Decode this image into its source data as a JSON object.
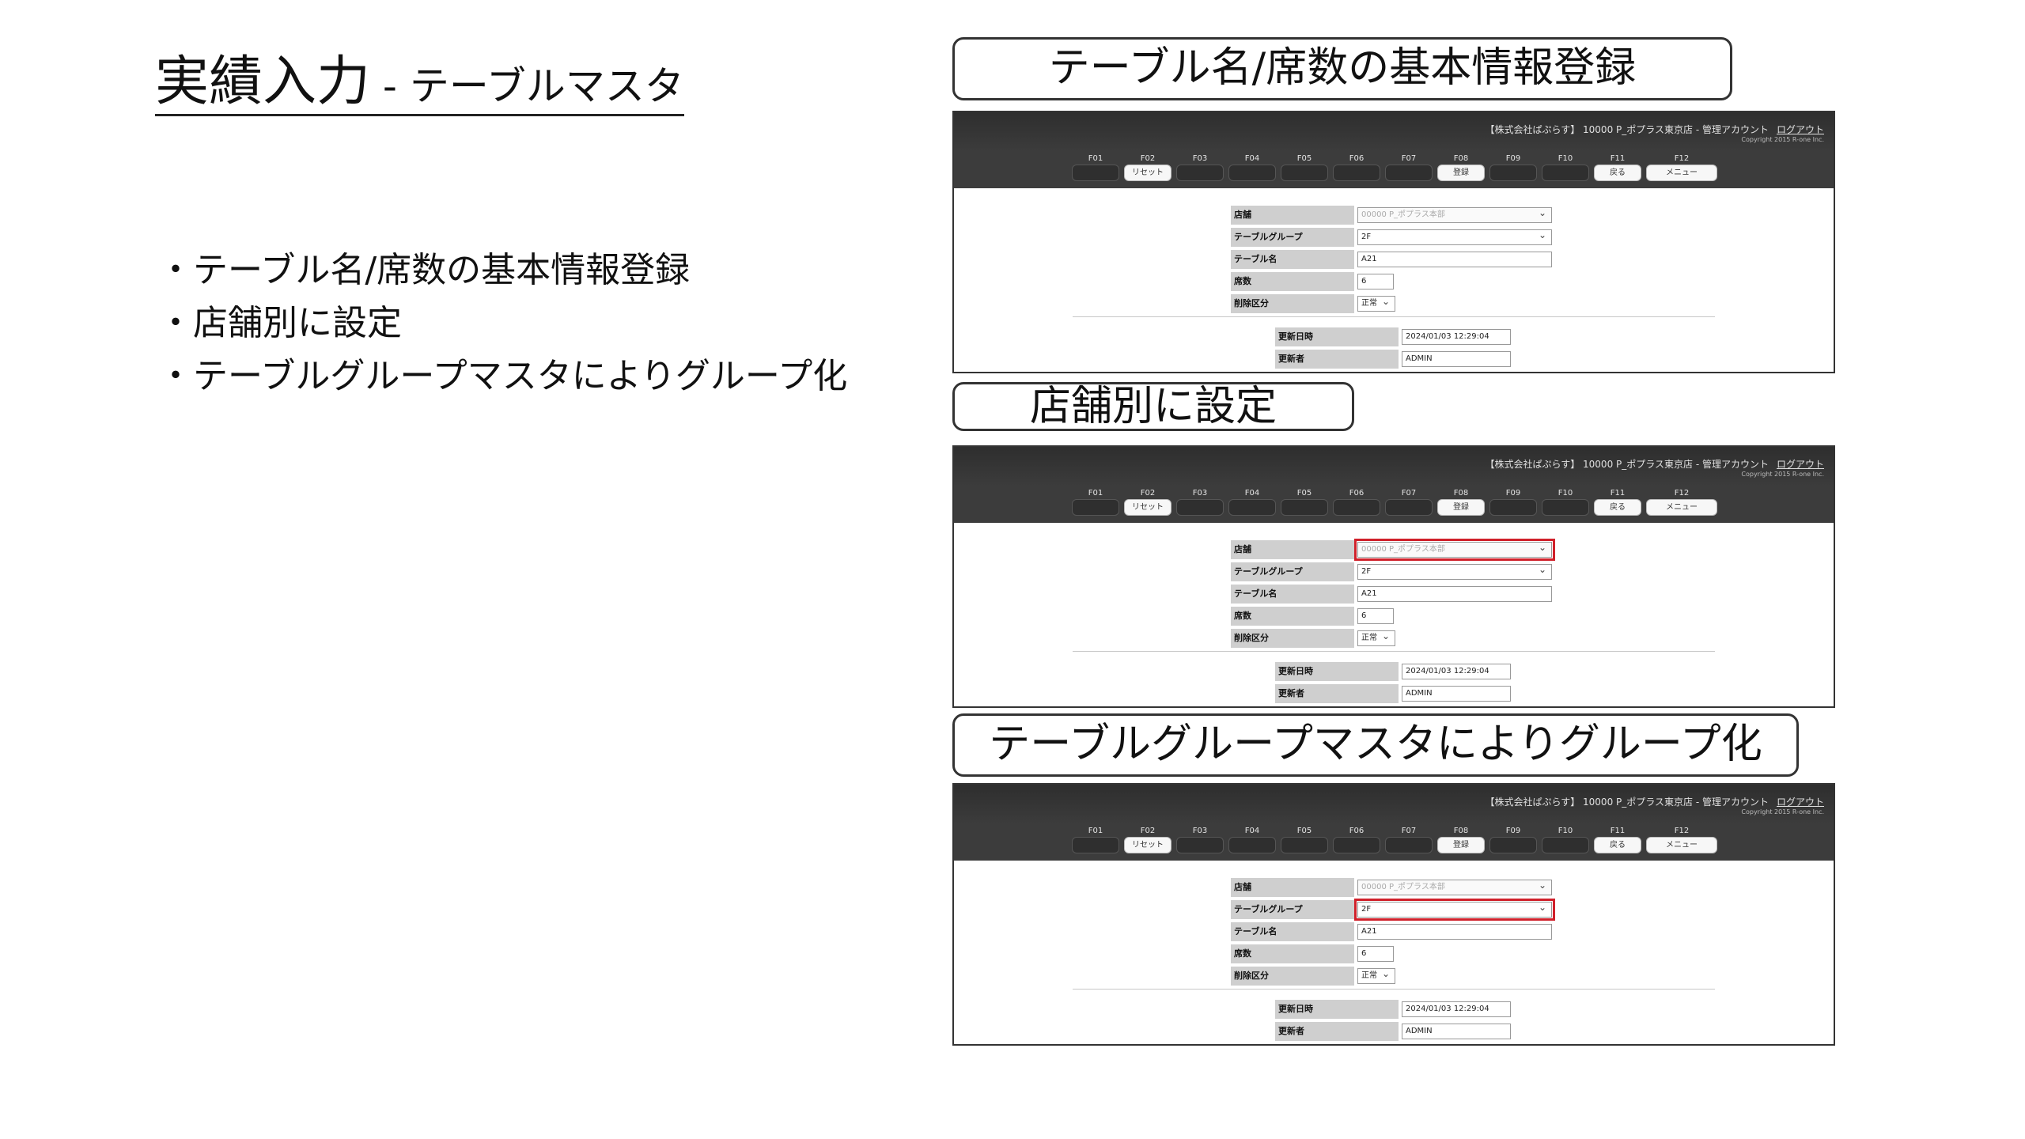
{
  "slide": {
    "title_main": "実績入力",
    "title_sub": " - テーブルマスタ",
    "bullets": [
      "・テーブル名/席数の基本情報登録",
      "・店舗別に設定",
      "・テーブルグループマスタによりグループ化"
    ]
  },
  "callouts": [
    "テーブル名/席数の基本情報登録",
    "店舗別に設定",
    "テーブルグループマスタによりグループ化"
  ],
  "app": {
    "header_info": "【株式会社ぱぷらす】 10000 P_ポプラス東京店 - 管理アカウント",
    "logout": "ログアウト",
    "copyright": "Copyright 2015 R-one Inc.",
    "fkeys": [
      {
        "key": "F01",
        "label": ""
      },
      {
        "key": "F02",
        "label": "リセット"
      },
      {
        "key": "F03",
        "label": ""
      },
      {
        "key": "F04",
        "label": ""
      },
      {
        "key": "F05",
        "label": ""
      },
      {
        "key": "F06",
        "label": ""
      },
      {
        "key": "F07",
        "label": ""
      },
      {
        "key": "F08",
        "label": "登録"
      },
      {
        "key": "F09",
        "label": ""
      },
      {
        "key": "F10",
        "label": ""
      },
      {
        "key": "F11",
        "label": "戻る"
      },
      {
        "key": "F12",
        "label": "メニュー"
      }
    ],
    "form": {
      "store_label": "店舗",
      "store_value": "00000 P_ポプラス本部",
      "group_label": "テーブルグループ",
      "group_value": "2F",
      "name_label": "テーブル名",
      "name_value": "A21",
      "seats_label": "席数",
      "seats_value": "6",
      "delete_label": "削除区分",
      "delete_value": "正常",
      "updated_label": "更新日時",
      "updated_value": "2024/01/03 12:29:04",
      "updater_label": "更新者",
      "updater_value": "ADMIN"
    }
  },
  "colors": {
    "highlight": "#d0202a",
    "header_bg": "#3c3c3c",
    "label_bg": "#cfcfcf"
  }
}
